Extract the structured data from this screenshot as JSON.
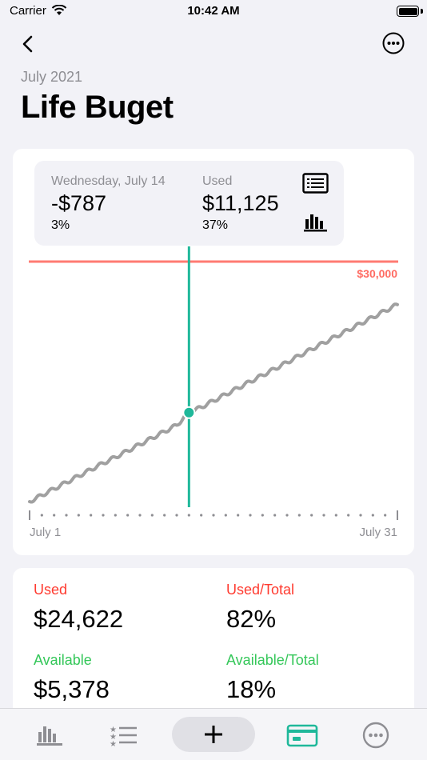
{
  "status": {
    "carrier": "Carrier",
    "time": "10:42 AM"
  },
  "header": {
    "period": "July 2021",
    "title": "Life Buget"
  },
  "tooltip": {
    "date": "Wednesday, July 14",
    "day_value": "-$787",
    "day_percent": "3%",
    "used_label": "Used",
    "used_value": "$11,125",
    "used_percent": "37%"
  },
  "chart_data": {
    "type": "line",
    "x_labels": [
      "July 1",
      "July 31"
    ],
    "budget_line_label": "$30,000",
    "budget_line_value": 30000,
    "x_range": [
      1,
      31
    ],
    "y_range": [
      0,
      30000
    ],
    "selected_day": 14,
    "series": [
      {
        "values": [
          [
            1,
            0
          ],
          [
            2,
            800
          ],
          [
            3,
            1600
          ],
          [
            4,
            2400
          ],
          [
            5,
            3200
          ],
          [
            6,
            4000
          ],
          [
            7,
            4800
          ],
          [
            8,
            5550
          ],
          [
            9,
            6350
          ],
          [
            10,
            7150
          ],
          [
            11,
            7950
          ],
          [
            12,
            8750
          ],
          [
            13,
            9550
          ],
          [
            14,
            11125
          ],
          [
            15,
            11800
          ],
          [
            16,
            12600
          ],
          [
            17,
            13400
          ],
          [
            18,
            14200
          ],
          [
            19,
            15000
          ],
          [
            20,
            15800
          ],
          [
            21,
            16600
          ],
          [
            22,
            17400
          ],
          [
            23,
            18250
          ],
          [
            24,
            19050
          ],
          [
            25,
            19850
          ],
          [
            26,
            20650
          ],
          [
            27,
            21450
          ],
          [
            28,
            22250
          ],
          [
            29,
            23050
          ],
          [
            30,
            23850
          ],
          [
            31,
            24622
          ]
        ]
      }
    ],
    "colors": {
      "budget": "#ff7b72",
      "line": "#a0a0a0",
      "cursor": "#1fb89a"
    }
  },
  "stats": {
    "used_label": "Used",
    "used_value": "$24,622",
    "used_total_label": "Used/Total",
    "used_total_value": "82%",
    "available_label": "Available",
    "available_value": "$5,378",
    "available_total_label": "Available/Total",
    "available_total_value": "18%"
  },
  "tabs": [
    "chart-icon",
    "list-icon",
    "add-icon",
    "card-icon",
    "more-icon"
  ],
  "accent": "#1fb89a"
}
